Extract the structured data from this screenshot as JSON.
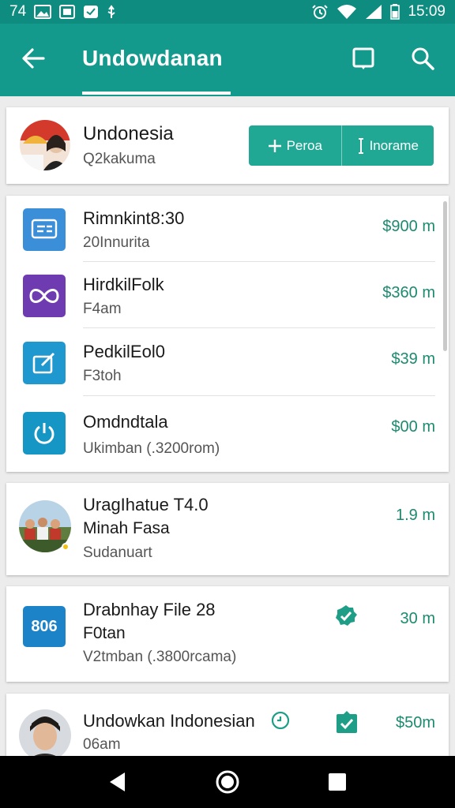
{
  "status_bar": {
    "time_left": "74",
    "time_right": "15:09"
  },
  "app_bar": {
    "title": "Undowdanan"
  },
  "profile": {
    "name": "Undonesia",
    "subtitle": "Q2kakuma",
    "button_add_label": "Peroa",
    "button_second_label": "Inorame"
  },
  "list": [
    {
      "title": "Rimnkint8:30",
      "subtitle": "20Innurita",
      "amount": "$900 m",
      "icon": "receipt-icon",
      "color": "#3b8fd9"
    },
    {
      "title": "HirdkilFolk",
      "subtitle": "F4am",
      "amount": "$360 m",
      "icon": "infinity-icon",
      "color": "#6f3bb0"
    },
    {
      "title": "PedkilEol0",
      "subtitle": "F3toh",
      "amount": "$39 m",
      "icon": "edit-icon",
      "color": "#1f97cf"
    },
    {
      "title": "Omdndtala",
      "subtitle": "Ukimban (.3200rom)",
      "amount": "$00 m",
      "icon": "power-icon",
      "color": "#1596c4"
    }
  ],
  "card_three": {
    "title": "UragIhatue T4.0",
    "line2": "Minah Fasa",
    "subtitle": "Sudanuart",
    "amount": "1.9 m"
  },
  "card_four": {
    "title": "Drabnhay File 28",
    "line2": "F0tan",
    "subtitle": "V2tmban (.3800rcama)",
    "amount": "30 m",
    "badge": "806"
  },
  "card_five": {
    "title": "Undowkan Indonesian",
    "subtitle": "06am",
    "amount": "$50m"
  }
}
